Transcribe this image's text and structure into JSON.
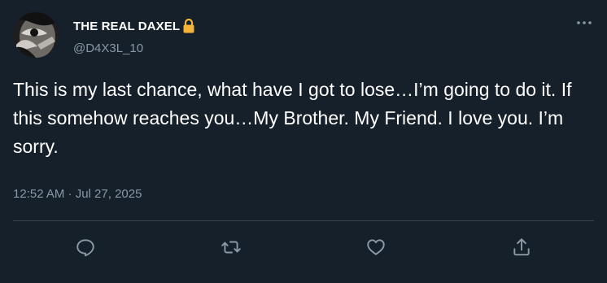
{
  "author": {
    "display_name": "THE REAL DAXEL",
    "handle": "@D4X3L_10",
    "verified_badge_icon": "lock-icon"
  },
  "tweet": {
    "text": "This is my last chance, what have I got to lose…I’m going to do it. If this somehow reaches you…My Brother. My Friend. I love you. I’m sorry.",
    "timestamp": "12:52 AM · Jul 27, 2025"
  },
  "actions": [
    {
      "name": "reply",
      "icon": "reply-icon"
    },
    {
      "name": "retweet",
      "icon": "retweet-icon"
    },
    {
      "name": "like",
      "icon": "heart-icon"
    },
    {
      "name": "share",
      "icon": "share-icon"
    }
  ],
  "colors": {
    "background": "#15202b",
    "text": "#ffffff",
    "secondary_text": "#8b98a5",
    "divider": "#38444d",
    "lock": "#f5b335"
  }
}
